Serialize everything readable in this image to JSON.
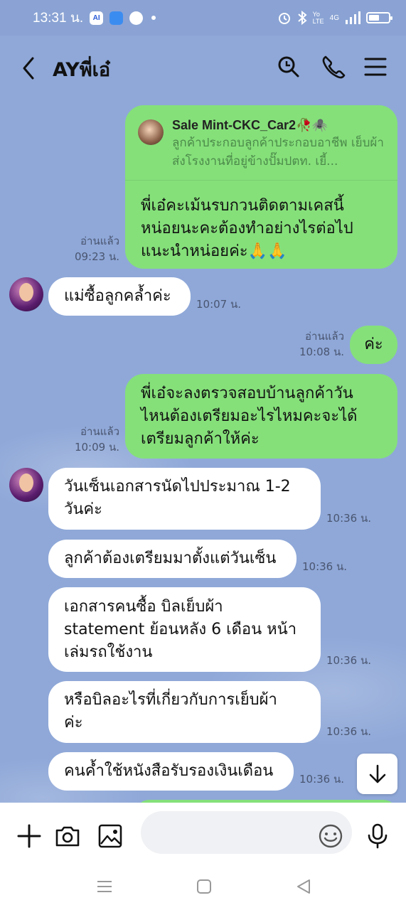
{
  "status_bar": {
    "time": "13:31 น.",
    "app_badge": "AI",
    "signal_text": "Yo LTE",
    "network": "4G"
  },
  "header": {
    "title": "AYพี่เอ๋",
    "icons": [
      "back-icon",
      "search-icon",
      "phone-icon",
      "menu-icon"
    ]
  },
  "messages": [
    {
      "dir": "out",
      "reply": {
        "name": "Sale Mint-CKC_Car2🥀🕷️",
        "text": "ลูกค้าประกอบลูกค้าประกอบอาชีพ เย็บผ้าส่งโรงงานที่อยู่ข้างปั๊มปตท. เยี้..."
      },
      "lines": [
        "พี่เอ๋คะเม้นรบกวนติดตามเคสนี้",
        "หน่อยนะคะต้องทำอย่างไรต่อไป",
        "แนะนำหน่อยค่ะ🙏🙏"
      ],
      "read": "อ่านแล้ว",
      "time": "09:23 น."
    },
    {
      "dir": "in",
      "lines": [
        "แม่ซื้อลูกคล้ำค่ะ"
      ],
      "time": "10:07 น."
    },
    {
      "dir": "out",
      "lines": [
        "ค่ะ"
      ],
      "read": "อ่านแล้ว",
      "time": "10:08 น."
    },
    {
      "dir": "out",
      "lines": [
        "พี่เอ๋จะลงตรวจสอบบ้านลูกค้าวัน",
        "ไหนต้องเตรียมอะไรไหมคะจะได้",
        "เตรียมลูกค้าให้ค่ะ"
      ],
      "read": "อ่านแล้ว",
      "time": "10:09 น."
    },
    {
      "dir": "in",
      "lines": [
        "วันเซ็นเอกสารนัดไปประมาณ 1-2",
        "วันค่ะ"
      ],
      "time": "10:36 น."
    },
    {
      "dir": "in",
      "lines": [
        "ลูกค้าต้องเตรียมมาตั้งแต่วันเซ็น"
      ],
      "time": "10:36 น."
    },
    {
      "dir": "in",
      "lines": [
        "เอกสารคนซื้อ บิลเย็บผ้า",
        "statement ย้อนหลัง 6 เดือน หน้า",
        "เล่มรถใช้งาน"
      ],
      "time": "10:36 น."
    },
    {
      "dir": "in",
      "lines": [
        "หรือบิลอะไรที่เกี่ยวกับการเย็บผ้า",
        "ค่ะ"
      ],
      "time": "10:36 น."
    },
    {
      "dir": "in",
      "lines": [
        "คนค้ำใช้หนังสือรับรองเงินเดือน"
      ],
      "time": "10:36 น."
    }
  ],
  "input": {
    "placeholder": "",
    "icons": [
      "plus-icon",
      "camera-icon",
      "image-icon",
      "emoji-icon",
      "mic-icon"
    ]
  },
  "colors": {
    "background": "#8fa8d8",
    "outgoing": "#85e07a",
    "incoming": "#ffffff"
  }
}
